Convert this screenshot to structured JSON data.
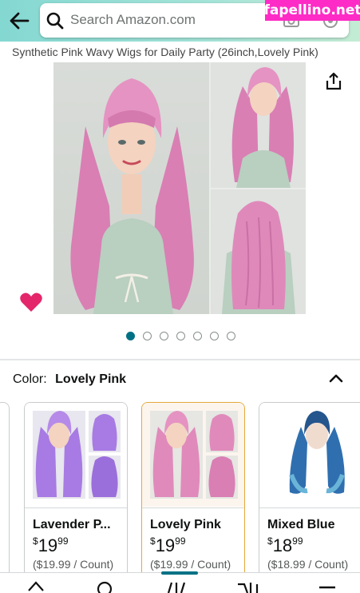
{
  "watermark": "fapellino.net",
  "search": {
    "placeholder": "Search Amazon.com"
  },
  "product": {
    "title": "Synthetic Pink Wavy Wigs for Daily Party (26inch,Lovely Pink)"
  },
  "gallery": {
    "dot_count": 7,
    "active_dot": 0
  },
  "colors": {
    "accent": "#007185",
    "selected_border": "#e4a93a",
    "heart": "#e4266a",
    "wig_pink": "#e08abb",
    "wig_lavender": "#a77be3",
    "wig_blue": "#2f6fb0"
  },
  "color_selector": {
    "label": "Color:",
    "selected": "Lovely Pink",
    "options": [
      {
        "name": "Lavender P...",
        "currency": "$",
        "price_whole": "19",
        "price_cents": "99",
        "unit_price": "($19.99 / Count)"
      },
      {
        "name": "Lovely Pink",
        "currency": "$",
        "price_whole": "19",
        "price_cents": "99",
        "unit_price": "($19.99 / Count)"
      },
      {
        "name": "Mixed Blue",
        "currency": "$",
        "price_whole": "18",
        "price_cents": "99",
        "unit_price": "($18.99 / Count)"
      }
    ]
  },
  "icons": {
    "back": "arrow-left-icon",
    "search": "search-icon",
    "camera": "camera-icon",
    "mic": "mic-icon",
    "share": "share-icon",
    "heart": "heart-icon",
    "collapse": "chevron-up-icon"
  }
}
